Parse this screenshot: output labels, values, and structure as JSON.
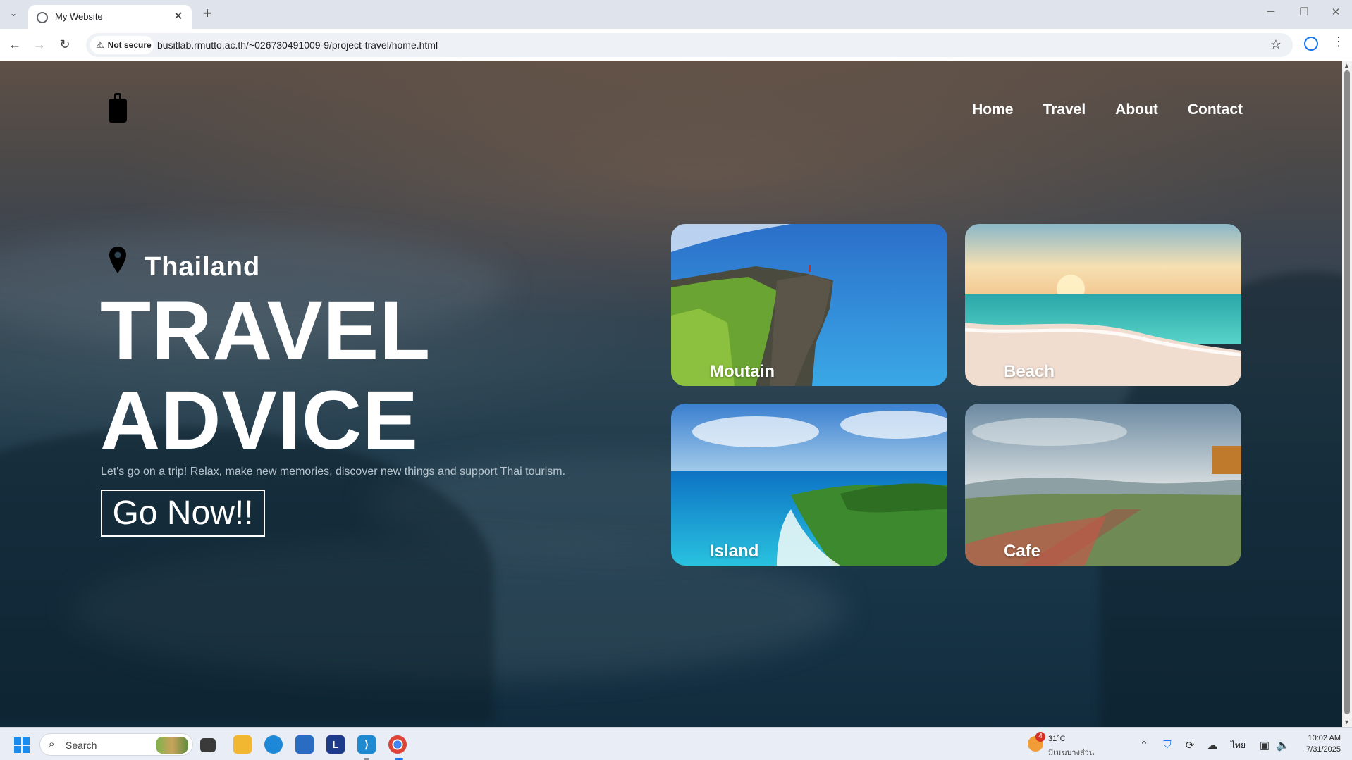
{
  "browser": {
    "tab_title": "My Website",
    "security_label": "Not secure",
    "url": "busitlab.rmutto.ac.th/~026730491009-9/project-travel/home.html"
  },
  "site": {
    "nav": [
      "Home",
      "Travel",
      "About",
      "Contact"
    ],
    "hero": {
      "country": "Thailand",
      "title_line1": "TRAVEL",
      "title_line2": "ADVICE",
      "tagline": "Let's go on a trip! Relax, make new memories, discover new things and support Thai tourism.",
      "cta": "Go Now!!"
    },
    "cards": [
      {
        "label": "Moutain"
      },
      {
        "label": "Beach"
      },
      {
        "label": "Island"
      },
      {
        "label": "Cafe"
      }
    ]
  },
  "taskbar": {
    "search_placeholder": "Search",
    "weather_temp": "31°C",
    "weather_desc": "มีเมฆบางส่วน",
    "weather_badge": "4",
    "language": "ไทย",
    "time": "10:02 AM",
    "date": "7/31/2025"
  },
  "icons": {
    "accent": "#1a73e8",
    "start": "windows-start-icon"
  }
}
